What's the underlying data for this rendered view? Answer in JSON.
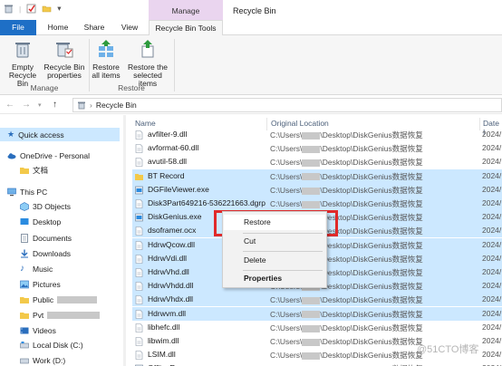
{
  "window": {
    "title": "Recycle Bin"
  },
  "ribbon_tabs": {
    "file": "File",
    "home": "Home",
    "share": "Share",
    "view": "View",
    "context_group": "Manage",
    "context_tab": "Recycle Bin Tools"
  },
  "ribbon": {
    "empty": "Empty Recycle Bin",
    "properties": "Recycle Bin properties",
    "restore_all": "Restore all items",
    "restore_selected": "Restore the selected items",
    "group_manage": "Manage",
    "group_restore": "Restore"
  },
  "address": {
    "path": "Recycle Bin"
  },
  "nav_pane": {
    "items": [
      {
        "label": "Quick access",
        "icon": "star-icon"
      },
      {
        "label": "OneDrive - Personal",
        "icon": "cloud-icon"
      },
      {
        "label": "文档",
        "icon": "folder-icon"
      },
      {
        "label": "This PC",
        "icon": "pc-icon"
      },
      {
        "label": "3D Objects",
        "icon": "cube-icon"
      },
      {
        "label": "Desktop",
        "icon": "desktop-icon"
      },
      {
        "label": "Documents",
        "icon": "documents-icon"
      },
      {
        "label": "Downloads",
        "icon": "download-icon"
      },
      {
        "label": "Music",
        "icon": "music-icon"
      },
      {
        "label": "Pictures",
        "icon": "pictures-icon"
      },
      {
        "label": "Public",
        "icon": "folder-icon"
      },
      {
        "label": "Pvt",
        "icon": "folder-icon"
      },
      {
        "label": "Videos",
        "icon": "videos-icon"
      },
      {
        "label": "Local Disk (C:)",
        "icon": "drive-icon"
      },
      {
        "label": "Work (D:)",
        "icon": "drive-icon"
      }
    ]
  },
  "columns": {
    "name": "Name",
    "original_location": "Original Location",
    "date": "Date I"
  },
  "files": [
    {
      "name": "avfilter-9.dll",
      "loc_a": "C:\\Users\\",
      "loc_b": "\\Desktop\\DiskGenius数据恢复",
      "date": "2024/",
      "selected": false
    },
    {
      "name": "avformat-60.dll",
      "loc_a": "C:\\Users\\",
      "loc_b": "\\Desktop\\DiskGenius数据恢复",
      "date": "2024/",
      "selected": false
    },
    {
      "name": "avutil-58.dll",
      "loc_a": "C:\\Users\\",
      "loc_b": "\\Desktop\\DiskGenius数据恢复",
      "date": "2024/",
      "selected": false
    },
    {
      "name": "BT Record",
      "loc_a": "C:\\Users\\",
      "loc_b": "\\Desktop\\DiskGenius数据恢复",
      "date": "2024/",
      "selected": true
    },
    {
      "name": "DGFileViewer.exe",
      "loc_a": "C:\\Users\\",
      "loc_b": "\\Desktop\\DiskGenius数据恢复",
      "date": "2024/",
      "selected": true
    },
    {
      "name": "Disk3Part649216-536221663.dgrp",
      "loc_a": "C:\\Users\\",
      "loc_b": "\\Desktop\\DiskGenius数据恢复",
      "date": "2024/",
      "selected": true
    },
    {
      "name": "DiskGenius.exe",
      "loc_a": "C:\\Users\\",
      "loc_b": "\\Desktop\\DiskGenius数据恢复",
      "date": "2024/",
      "selected": true
    },
    {
      "name": "dsoframer.ocx",
      "loc_a": "C:\\Users\\",
      "loc_b": "\\Desktop\\DiskGenius数据恢复",
      "date": "2024/",
      "selected": true
    },
    {
      "name": "HdrwQcow.dll",
      "loc_a": "C:\\Users\\",
      "loc_b": "\\Desktop\\DiskGenius数据恢复",
      "date": "2024/",
      "selected": true
    },
    {
      "name": "HdrwVdi.dll",
      "loc_a": "C:\\Users\\",
      "loc_b": "\\Desktop\\DiskGenius数据恢复",
      "date": "2024/",
      "selected": true
    },
    {
      "name": "HdrwVhd.dll",
      "loc_a": "C:\\Users\\",
      "loc_b": "\\Desktop\\DiskGenius数据恢复",
      "date": "2024/",
      "selected": true
    },
    {
      "name": "HdrwVhdd.dll",
      "loc_a": "C:\\Users\\",
      "loc_b": "\\Desktop\\DiskGenius数据恢复",
      "date": "2024/",
      "selected": true
    },
    {
      "name": "HdrwVhdx.dll",
      "loc_a": "C:\\Users\\",
      "loc_b": "\\Desktop\\DiskGenius数据恢复",
      "date": "2024/",
      "selected": true
    },
    {
      "name": "Hdrwvm.dll",
      "loc_a": "C:\\Users\\",
      "loc_b": "\\Desktop\\DiskGenius数据恢复",
      "date": "2024/",
      "selected": true
    },
    {
      "name": "libhefc.dll",
      "loc_a": "C:\\Users\\",
      "loc_b": "\\Desktop\\DiskGenius数据恢复",
      "date": "2024/",
      "selected": false
    },
    {
      "name": "libwim.dll",
      "loc_a": "C:\\Users\\",
      "loc_b": "\\Desktop\\DiskGenius数据恢复",
      "date": "2024/",
      "selected": false
    },
    {
      "name": "LSIM.dll",
      "loc_a": "C:\\Users\\",
      "loc_b": "\\Desktop\\DiskGenius数据恢复",
      "date": "2024/",
      "selected": false
    },
    {
      "name": "OfflineReg.exe",
      "loc_a": "C:\\Users\\",
      "loc_b": "\\Desktop\\DiskGenius数据恢复",
      "date": "2024/",
      "selected": false
    }
  ],
  "context_menu": {
    "restore": "Restore",
    "cut": "Cut",
    "delete": "Delete",
    "properties": "Properties"
  },
  "watermark": "@51CTO博客",
  "colors": {
    "selection": "#cce8ff",
    "accent": "#1e6fc6",
    "highlight": "#e02a2a",
    "manage_tab": "#ead5ef"
  }
}
